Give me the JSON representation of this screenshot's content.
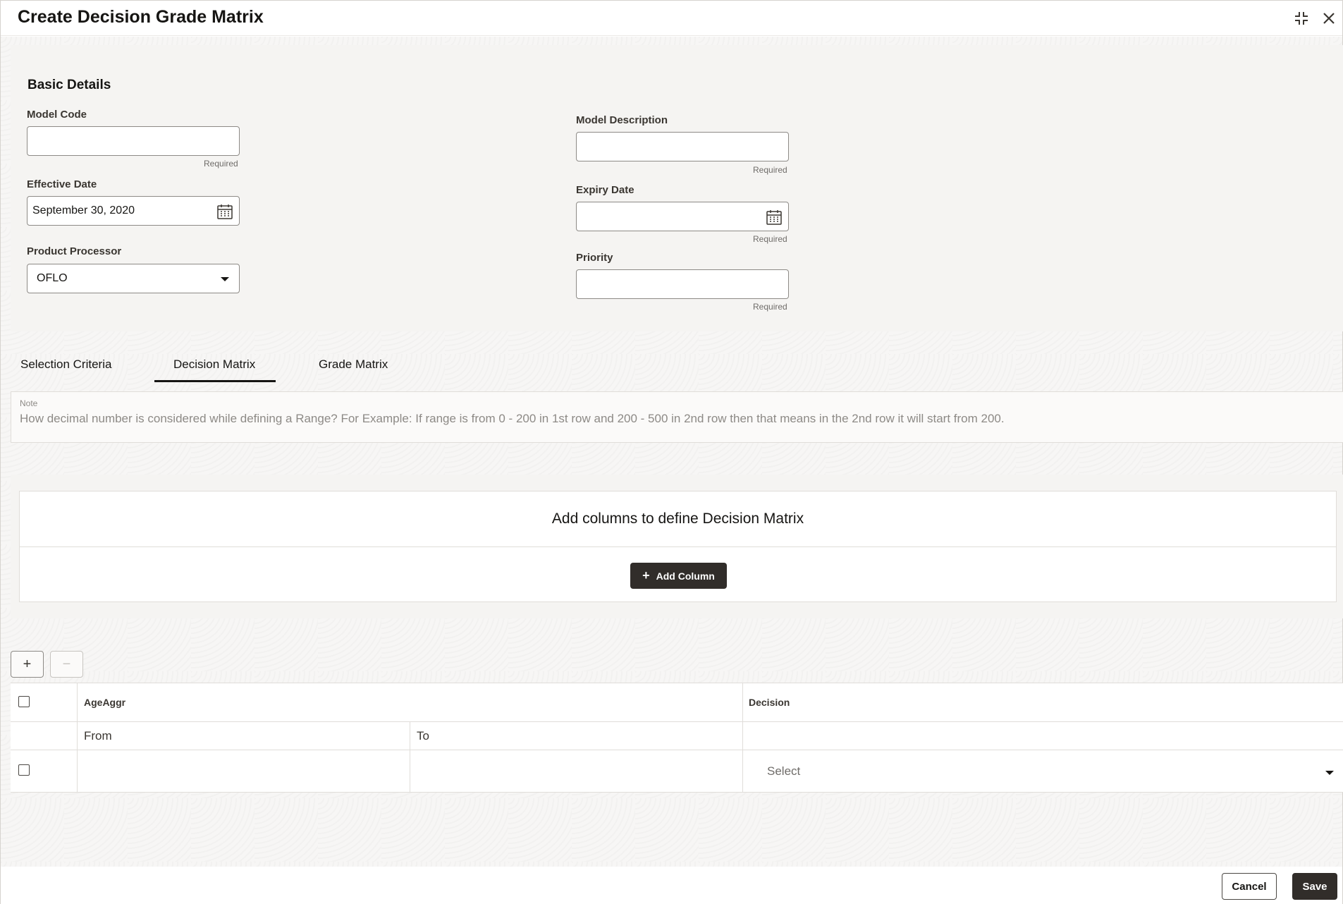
{
  "header": {
    "title": "Create Decision Grade Matrix"
  },
  "basic_details": {
    "section_title": "Basic Details",
    "model_code": {
      "label": "Model Code",
      "value": "",
      "helper": "Required"
    },
    "model_description": {
      "label": "Model Description",
      "value": "",
      "helper": "Required"
    },
    "effective_date": {
      "label": "Effective Date",
      "value": "September 30, 2020"
    },
    "expiry_date": {
      "label": "Expiry Date",
      "value": "",
      "helper": "Required"
    },
    "product_processor": {
      "label": "Product Processor",
      "value": "OFLO"
    },
    "priority": {
      "label": "Priority",
      "value": "",
      "helper": "Required"
    }
  },
  "tabs": [
    {
      "label": "Selection Criteria",
      "active": false
    },
    {
      "label": "Decision Matrix",
      "active": true
    },
    {
      "label": "Grade Matrix",
      "active": false
    }
  ],
  "note": {
    "label": "Note",
    "text": "How decimal number is considered while defining a Range? For Example: If range is from 0 - 200 in 1st row and 200 - 500 in 2nd row then that means in the 2nd row it will start from 200."
  },
  "decision_matrix": {
    "title": "Add columns to define Decision Matrix",
    "add_column_label": "Add Column"
  },
  "table": {
    "add_row_label": "+",
    "remove_row_label": "−",
    "group_header": "AgeAggr",
    "decision_header": "Decision",
    "sub_headers": [
      "From",
      "To"
    ],
    "rows": [
      {
        "from": "",
        "to": "",
        "decision_placeholder": "Select"
      }
    ]
  },
  "footer": {
    "cancel_label": "Cancel",
    "save_label": "Save"
  },
  "colors": {
    "primary_button": "#312d2a",
    "panel_bg": "#f5f4f2",
    "border": "#e0ddd9"
  }
}
